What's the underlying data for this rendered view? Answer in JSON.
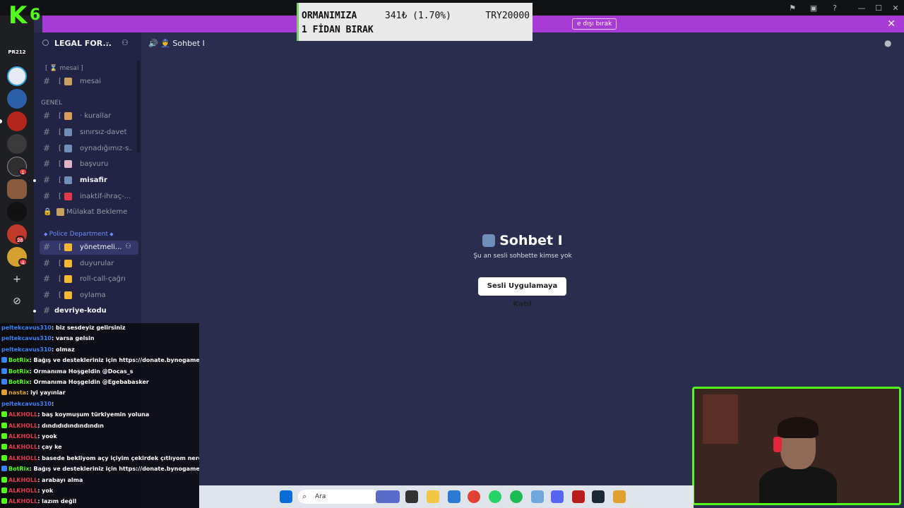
{
  "window": {
    "controls": {
      "minimize": "—",
      "maximize": "☐",
      "close": "✕"
    }
  },
  "banner": {
    "button_label": "e dışı bırak",
    "close": "✕"
  },
  "stream_logo": {
    "letter": "K",
    "digit": "6"
  },
  "donation": {
    "line1": "ORMANIMIZA",
    "line2": "1 FİDAN BIRAK",
    "amount": "341₺ (1.70%)",
    "goal": "TRY20000"
  },
  "rail": {
    "label_top": "PR212",
    "badges": [
      "1",
      "26",
      "4"
    ],
    "add_server": "+",
    "discover": "⊘"
  },
  "server": {
    "name": "LEGAL FOR..."
  },
  "categories": {
    "mesai_top": "[ ⌛ mesai ]",
    "genel": "GENEL",
    "police": "Police Department"
  },
  "channels": [
    {
      "bracket": "[",
      "name": "mesai",
      "emoji_color": "#c9a060",
      "bold": false,
      "hash": "#"
    },
    {
      "bracket": "[",
      "name": "· kurallar",
      "emoji_color": "#d99c5a",
      "bold": false,
      "hash": "#"
    },
    {
      "bracket": "[",
      "name": "sınırsız-davet",
      "emoji_color": "#6f8fb8",
      "bold": false,
      "hash": "#"
    },
    {
      "bracket": "[",
      "name": "oynadığımız-s...",
      "emoji_color": "#6f8fb8",
      "bold": false,
      "hash": "#"
    },
    {
      "bracket": "[",
      "name": "başvuru",
      "emoji_color": "#e0b4c8",
      "bold": false,
      "hash": "#"
    },
    {
      "bracket": "[",
      "name": "misafir",
      "emoji_color": "#6f8fb8",
      "bold": true,
      "hash": "#"
    },
    {
      "bracket": "[",
      "name": "inaktif-ihraç-...",
      "emoji_color": "#e23a4a",
      "bold": false,
      "hash": "#"
    },
    {
      "bracket": "",
      "name": "Mülakat Bekleme",
      "emoji_color": "#c9a060",
      "bold": false,
      "hash": "🔒"
    },
    {
      "bracket": "[",
      "name": "yönetmeli...",
      "emoji_color": "#f5b731",
      "bold": false,
      "hash": "#"
    },
    {
      "bracket": "[",
      "name": "duyurular",
      "emoji_color": "#f5b731",
      "bold": false,
      "hash": "#"
    },
    {
      "bracket": "[",
      "name": "roll-call-çağrı",
      "emoji_color": "#f5b731",
      "bold": false,
      "hash": "#"
    },
    {
      "bracket": "[",
      "name": "oylama",
      "emoji_color": "#f5b731",
      "bold": false,
      "hash": "#"
    },
    {
      "bracket": "",
      "name": "devriye-kodu",
      "emoji_color": "",
      "bold": true,
      "hash": "#"
    }
  ],
  "chat_header": {
    "title": "🔊 👮 Sohbet I"
  },
  "voice": {
    "title": "Sohbet I",
    "subtitle": "Şu an sesli sohbette kimse yok",
    "join_button": "Sesli Uygulamaya Katıl"
  },
  "chat": [
    {
      "user": "peltekcavus310",
      "text": ": biz sesdeyiz gelirsiniz",
      "color": "#3b82f6",
      "badge": ""
    },
    {
      "user": "peltekcavus310",
      "text": ": varsa gelsin",
      "color": "#3b82f6",
      "badge": ""
    },
    {
      "user": "peltekcavus310",
      "text": ": olmaz",
      "color": "#3b82f6",
      "badge": ""
    },
    {
      "user": "BotRix",
      "text": ": Bağış ve destekleriniz için https://donate.bynogame.com/isis",
      "color": "#53fc18",
      "badge": "#3b82f6"
    },
    {
      "user": "BotRix",
      "text": ": Ormanıma Hoşgeldin @Docas_s",
      "color": "#53fc18",
      "badge": "#3b82f6"
    },
    {
      "user": "BotRix",
      "text": ": Ormanıma Hoşgeldin @Egebabasker",
      "color": "#53fc18",
      "badge": "#3b82f6"
    },
    {
      "user": "nasta",
      "text": ": iyi yayınlar",
      "color": "#e0a030",
      "badge": "#e0a030"
    },
    {
      "user": "peltekcavus310",
      "text": ":",
      "color": "#3b82f6",
      "badge": ""
    },
    {
      "user": "ALKHOLL",
      "text": ": baş koymuşum türkiyemin yoluna",
      "color": "#e23a4a",
      "badge": "#53fc18"
    },
    {
      "user": "ALKHOLL",
      "text": ": dındıdıdındındındın",
      "color": "#e23a4a",
      "badge": "#53fc18"
    },
    {
      "user": "ALKHOLL",
      "text": ": yook",
      "color": "#e23a4a",
      "badge": "#53fc18"
    },
    {
      "user": "ALKHOLL",
      "text": ": çay ke",
      "color": "#e23a4a",
      "badge": "#53fc18"
    },
    {
      "user": "ALKHOLL",
      "text": ": basede bekliyom açy içiyim çekirdek çıtlıyom nerdesiniz",
      "color": "#e23a4a",
      "badge": "#53fc18"
    },
    {
      "user": "BotRix",
      "text": ": Bağış ve destekleriniz için https://donate.bynogame.com/isis",
      "color": "#53fc18",
      "badge": "#3b82f6"
    },
    {
      "user": "ALKHOLL",
      "text": ": arabayı alma",
      "color": "#e23a4a",
      "badge": "#53fc18"
    },
    {
      "user": "ALKHOLL",
      "text": ": yok",
      "color": "#e23a4a",
      "badge": "#53fc18"
    },
    {
      "user": "ALKHOLL",
      "text": ": lazım değil",
      "color": "#e23a4a",
      "badge": "#53fc18"
    }
  ],
  "taskbar": {
    "search_placeholder": "Ara",
    "start_icon": "windows-start-icon",
    "search_icon": "⌕"
  }
}
